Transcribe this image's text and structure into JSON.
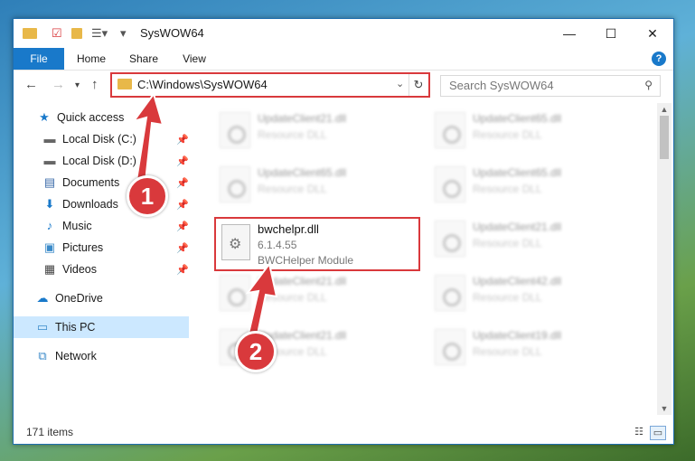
{
  "window": {
    "title": "SysWOW64",
    "controls": {
      "minimize": "—",
      "maximize": "☐",
      "close": "✕"
    }
  },
  "ribbon": {
    "tabs": [
      {
        "label": "File"
      },
      {
        "label": "Home"
      },
      {
        "label": "Share"
      },
      {
        "label": "View"
      }
    ],
    "help": "?"
  },
  "address": {
    "path": "C:\\Windows\\SysWOW64",
    "search_placeholder": "Search SysWOW64"
  },
  "sidebar": {
    "quick_access": "Quick access",
    "items": [
      {
        "label": "Local Disk (C:)",
        "icon": "drive-icon"
      },
      {
        "label": "Local Disk (D:)",
        "icon": "drive-icon"
      },
      {
        "label": "Documents",
        "icon": "documents-icon"
      },
      {
        "label": "Downloads",
        "icon": "downloads-icon"
      },
      {
        "label": "Music",
        "icon": "music-icon"
      },
      {
        "label": "Pictures",
        "icon": "pictures-icon"
      },
      {
        "label": "Videos",
        "icon": "videos-icon"
      }
    ],
    "onedrive": "OneDrive",
    "this_pc": "This PC",
    "network": "Network"
  },
  "files": {
    "blurred": [
      {
        "name": "UpdateClient21.dll",
        "desc": "Resource DLL"
      },
      {
        "name": "UpdateClient65.dll",
        "desc": "Resource DLL"
      },
      {
        "name": "UpdateClient65.dll",
        "desc": "Resource DLL"
      },
      {
        "name": "UpdateClient65.dll",
        "desc": "Resource DLL"
      },
      {
        "name": "UpdateClient21.dll",
        "desc": "Resource DLL"
      },
      {
        "name": "UpdateClient21.dll",
        "desc": "Resource DLL"
      },
      {
        "name": "UpdateClient42.dll",
        "desc": "Resource DLL"
      },
      {
        "name": "UpdateClient21.dll",
        "desc": "Resource DLL"
      },
      {
        "name": "UpdateClient19.dll",
        "desc": "Resource DLL"
      }
    ],
    "selected": {
      "name": "bwchelpr.dll",
      "version": "6.1.4.55",
      "desc": "BWCHelper Module"
    }
  },
  "status": {
    "count": "171 items"
  },
  "callouts": {
    "one": "1",
    "two": "2"
  },
  "colors": {
    "accent": "#1979ca",
    "highlight": "#d9393c",
    "selected_nav": "#cce8ff"
  }
}
